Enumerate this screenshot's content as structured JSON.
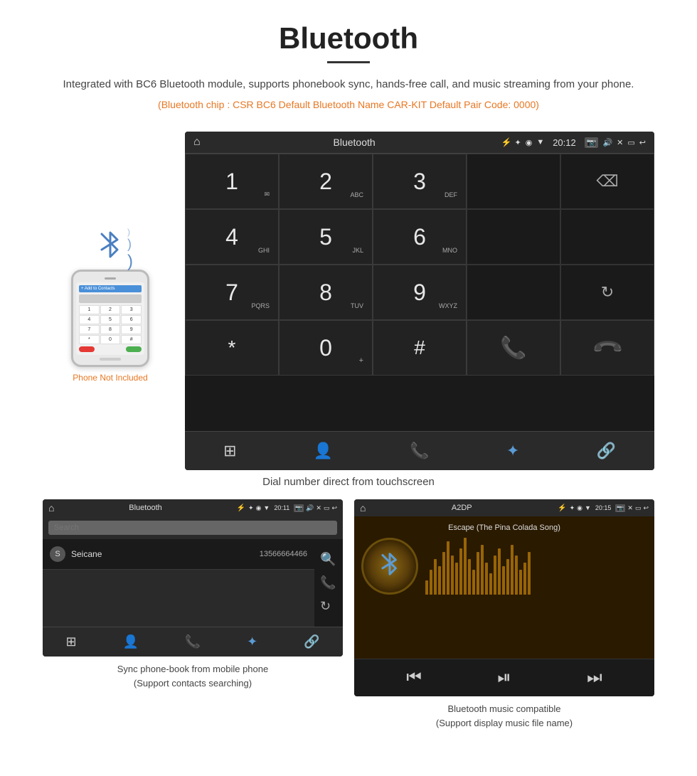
{
  "title": {
    "main": "Bluetooth",
    "underline": true
  },
  "description": {
    "text": "Integrated with BC6 Bluetooth module, supports phonebook sync, hands-free call, and music streaming from your phone.",
    "orange_info": "(Bluetooth chip : CSR BC6    Default Bluetooth Name CAR-KIT    Default Pair Code: 0000)"
  },
  "main_screen": {
    "status_bar": {
      "title": "Bluetooth",
      "time": "20:12",
      "usb_icon": "⚡",
      "bt_icon": "✦",
      "location_icon": "◉",
      "signal_icon": "▼",
      "camera_icon": "📷",
      "volume_icon": "🔊",
      "x_icon": "✕",
      "rect_icon": "⬜",
      "back_icon": "↩"
    },
    "dialpad": {
      "keys": [
        {
          "num": "1",
          "sub": "✉"
        },
        {
          "num": "2",
          "sub": "ABC"
        },
        {
          "num": "3",
          "sub": "DEF"
        },
        {
          "num": "",
          "sub": ""
        },
        {
          "num": "⌫",
          "sub": ""
        }
      ],
      "row2": [
        {
          "num": "4",
          "sub": "GHI"
        },
        {
          "num": "5",
          "sub": "JKL"
        },
        {
          "num": "6",
          "sub": "MNO"
        },
        {
          "num": "",
          "sub": ""
        },
        {
          "num": "",
          "sub": ""
        }
      ],
      "row3": [
        {
          "num": "7",
          "sub": "PQRS"
        },
        {
          "num": "8",
          "sub": "TUV"
        },
        {
          "num": "9",
          "sub": "WXYZ"
        },
        {
          "num": "",
          "sub": ""
        },
        {
          "num": "↻",
          "sub": ""
        }
      ],
      "row4": [
        {
          "num": "*",
          "sub": ""
        },
        {
          "num": "0",
          "sub": "+"
        },
        {
          "num": "#",
          "sub": ""
        },
        {
          "num": "📞",
          "sub": ""
        },
        {
          "num": "📞",
          "sub": ""
        }
      ]
    },
    "bottom_nav": [
      "⊞",
      "👤",
      "📞",
      "✦",
      "🔗"
    ],
    "caption": "Dial number direct from touchscreen"
  },
  "phone_sidebar": {
    "bt_label": "Bluetooth signal",
    "not_included": "Phone Not Included"
  },
  "phonebook_screen": {
    "title": "Bluetooth",
    "time": "20:11",
    "search_placeholder": "Search",
    "contacts": [
      {
        "initial": "S",
        "name": "Seicane",
        "number": "13566664466"
      }
    ],
    "side_icons": [
      "🔍",
      "📞",
      "↻"
    ],
    "bottom_nav": [
      "⊞",
      "👤",
      "📞",
      "✦",
      "🔗"
    ],
    "caption_line1": "Sync phone-book from mobile phone",
    "caption_line2": "(Support contacts searching)"
  },
  "music_screen": {
    "title": "A2DP",
    "time": "20:15",
    "song_title": "Escape (The Pina Colada Song)",
    "viz_bars": [
      20,
      35,
      50,
      40,
      60,
      75,
      55,
      45,
      65,
      80,
      50,
      35,
      60,
      70,
      45,
      30,
      55,
      65,
      40,
      50,
      70,
      55,
      35,
      45,
      60
    ],
    "controls": [
      "⏮",
      "⏯",
      "⏭"
    ],
    "caption_line1": "Bluetooth music compatible",
    "caption_line2": "(Support display music file name)"
  }
}
